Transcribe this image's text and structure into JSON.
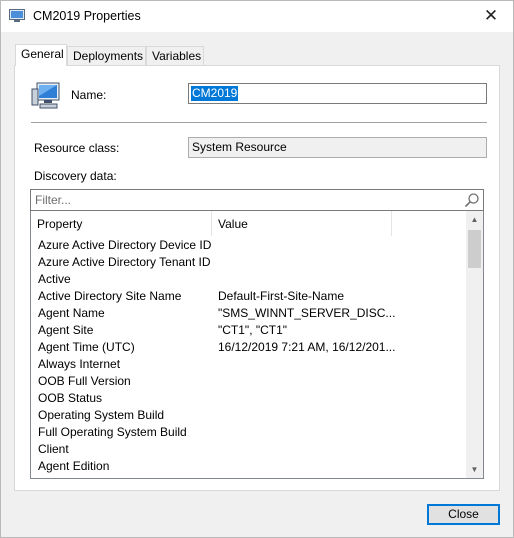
{
  "window": {
    "title": "CM2019 Properties"
  },
  "tabs": [
    {
      "label": "General",
      "active": true
    },
    {
      "label": "Deployments",
      "active": false
    },
    {
      "label": "Variables",
      "active": false
    }
  ],
  "general": {
    "name_label": "Name:",
    "name_value": "CM2019",
    "resource_class_label": "Resource class:",
    "resource_class_value": "System Resource",
    "discovery_label": "Discovery data:",
    "filter_placeholder": "Filter..."
  },
  "discovery_table": {
    "columns": [
      "Property",
      "Value",
      ""
    ],
    "rows": [
      {
        "property": "Azure Active Directory Device ID",
        "value": ""
      },
      {
        "property": "Azure Active Directory Tenant ID",
        "value": ""
      },
      {
        "property": "Active",
        "value": ""
      },
      {
        "property": "Active Directory Site Name",
        "value": "Default-First-Site-Name"
      },
      {
        "property": "Agent Name",
        "value": "\"SMS_WINNT_SERVER_DISC..."
      },
      {
        "property": "Agent Site",
        "value": "\"CT1\", \"CT1\""
      },
      {
        "property": "Agent Time (UTC)",
        "value": "16/12/2019 7:21 AM, 16/12/201..."
      },
      {
        "property": "Always Internet",
        "value": ""
      },
      {
        "property": "OOB Full Version",
        "value": ""
      },
      {
        "property": "OOB Status",
        "value": ""
      },
      {
        "property": "Operating System Build",
        "value": ""
      },
      {
        "property": "Full Operating System Build",
        "value": ""
      },
      {
        "property": "Client",
        "value": ""
      },
      {
        "property": "Agent Edition",
        "value": ""
      }
    ]
  },
  "footer": {
    "close_label": "Close"
  },
  "colors": {
    "selection": "#0078d7",
    "accent": "#0078d7"
  }
}
